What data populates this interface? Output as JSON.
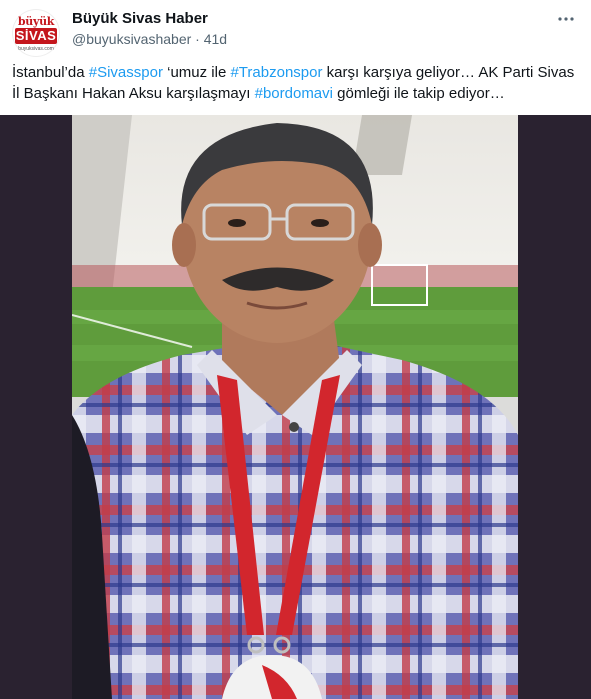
{
  "account": {
    "display_name": "Büyük Sivas Haber",
    "handle": "@buyuksivashaber",
    "separator": "·",
    "time": "41d",
    "avatar": {
      "top_text": "büyük",
      "main_text": "SİVAS",
      "bottom_text": "buyuksivas.com"
    }
  },
  "tweet": {
    "text_part1": "İstanbul’da ",
    "hashtag1": "#Sivasspor",
    "text_part2": " ‘umuz ile ",
    "hashtag2": "#Trabzonspor",
    "text_part3": " karşı karşıya geliyor… AK Parti Sivas İl Başkanı Hakan Aksu karşılaşmayı ",
    "hashtag3": "#bordomavi",
    "text_part4": " gömleği ile takip ediyor…"
  },
  "colors": {
    "hashtag": "#1d9bf0",
    "media_background": "#2a2230",
    "avatar_brand": "#c4161c"
  },
  "icons": {
    "more": "more-options-icon"
  }
}
